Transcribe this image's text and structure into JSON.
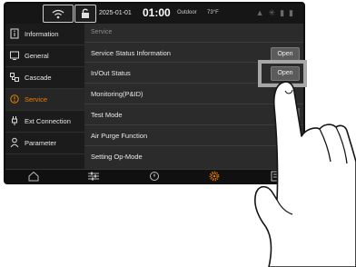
{
  "topbar": {
    "date": "2025-01-01",
    "time": "01:00",
    "outdoor_label": "Outdoor",
    "outdoor_temp": "73°F"
  },
  "sidebar": {
    "items": [
      {
        "label": "Information",
        "icon": "info-icon"
      },
      {
        "label": "General",
        "icon": "general-icon"
      },
      {
        "label": "Cascade",
        "icon": "cascade-icon"
      },
      {
        "label": "Service",
        "icon": "service-icon",
        "active": true
      },
      {
        "label": "Ext Connection",
        "icon": "ext-connection-icon"
      },
      {
        "label": "Parameter",
        "icon": "parameter-icon"
      }
    ]
  },
  "main": {
    "breadcrumb": "Service",
    "rows": [
      {
        "label": "Service Status Information",
        "button": "Open"
      },
      {
        "label": "In/Out Status",
        "button": "Open"
      },
      {
        "label": "Monitoring(P&ID)"
      },
      {
        "label": "Test Mode"
      },
      {
        "label": "Air Purge Function"
      },
      {
        "label": "Setting Op-Mode"
      }
    ]
  },
  "bottom_nav": [
    "home-icon",
    "sliders-icon",
    "power-icon",
    "gear-icon",
    "menu-icon"
  ],
  "colors": {
    "accent": "#f07d00",
    "background": "#2b2b2b",
    "sidebar": "#1b1b1b"
  }
}
